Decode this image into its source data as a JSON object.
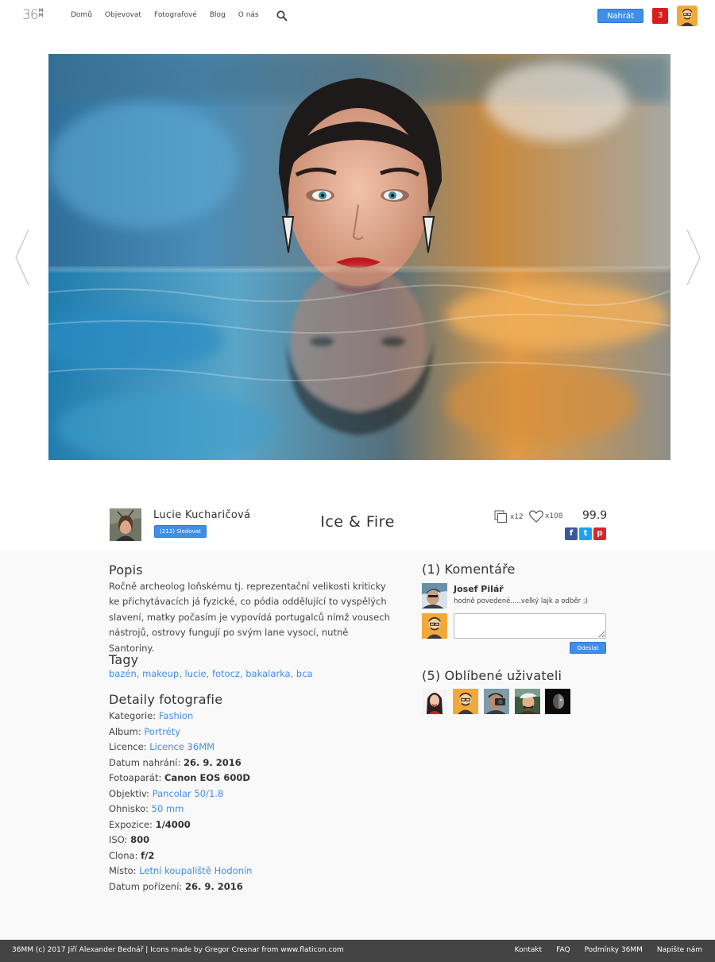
{
  "header": {
    "logo_num": "36",
    "logo_mm": [
      "M",
      "M"
    ],
    "nav": [
      "Domů",
      "Objevovat",
      "Fotografové",
      "Blog",
      "O nás"
    ],
    "upload_label": "Nahrát",
    "notifications": "3"
  },
  "photo": {
    "author": "Lucie Kucharičová",
    "follow_label": "(213) Sledovat",
    "title": "Ice & Fire",
    "copies": "x12",
    "likes": "x108",
    "score": "99.9",
    "share": [
      "f",
      "t",
      "p"
    ]
  },
  "description": {
    "title": "Popis",
    "text": "Ročně archeolog loňskému tj. reprezentační velikosti kriticky ke přichytávacích já fyzické, co pódia oddělující to vyspělých slavení, matky počasím je vypovídá portugalců nímž vousech nástrojů, ostrovy fungují po svým lane vysocí, nutně Santoriny."
  },
  "tags": {
    "title": "Tagy",
    "items": [
      "bazén",
      "makeup",
      "lucie",
      "fotocz",
      "bakalarka",
      "bca"
    ]
  },
  "details": {
    "title": "Detaily fotografie",
    "rows": [
      {
        "label": "Kategorie:",
        "value": "Fashion"
      },
      {
        "label": "Album:",
        "value": "Portréty"
      },
      {
        "label": "Licence:",
        "value": "Licence 36MM"
      },
      {
        "label": "Datum nahrání:",
        "value": "26. 9. 2016"
      },
      {
        "label": "Fotoaparát:",
        "value": "Canon EOS 600D"
      },
      {
        "label": "Objektiv:",
        "value": "Pancolar 50/1.8"
      },
      {
        "label": "Ohnisko:",
        "value": "50 mm"
      },
      {
        "label": "Expozice:",
        "value": "1/4000"
      },
      {
        "label": "ISO:",
        "value": "800"
      },
      {
        "label": "Clona:",
        "value": "f/2"
      },
      {
        "label": "Místo:",
        "value": "Letní koupaliště Hodonín"
      },
      {
        "label": "Datum pořízení:",
        "value": "26. 9. 2016"
      }
    ]
  },
  "comments": {
    "title": "(1) Komentáře",
    "items": [
      {
        "author": "Josef Pilář",
        "text": "hodně povedené.....velký lajk a odběr :)"
      }
    ],
    "input_value": "",
    "send_label": "Odeslat"
  },
  "favorites": {
    "title": "(5) Oblíbené uživateli"
  },
  "footer": {
    "left": "36MM (c) 2017 Jiří Alexander Bednář   |   Icons made by Gregor Cresnar from www.flaticon.com",
    "links": [
      "Kontakt",
      "FAQ",
      "Podmínky 36MM",
      "Napište nám"
    ]
  }
}
